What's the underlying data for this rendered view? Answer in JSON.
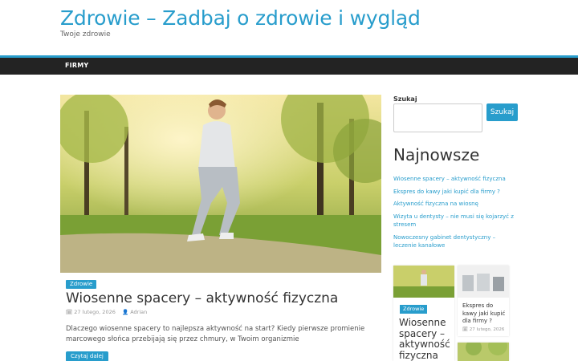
{
  "header": {
    "site_title": "Zdrowie – Zadbaj o zdrowie i wygląd",
    "tagline": "Twoje zdrowie"
  },
  "nav": {
    "items": [
      {
        "label": "FIRMY"
      }
    ]
  },
  "post": {
    "category": "Zdrowie",
    "title": "Wiosenne spacery – aktywność fizyczna",
    "date": "27 lutego, 2026",
    "author": "Adrian",
    "excerpt": "Dlaczego wiosenne spacery to najlepsza aktywność na start? Kiedy pierwsze promienie marcowego słońca przebijają się przez chmury, w Twoim organizmie",
    "read_more": "Czytaj dalej"
  },
  "sidebar": {
    "search_label": "Szukaj",
    "search_placeholder": "",
    "search_button": "Szukaj",
    "recent_title": "Najnowsze",
    "recent_posts": [
      {
        "label": "Wiosenne spacery – aktywność fizyczna"
      },
      {
        "label": "Ekspres do kawy jaki kupić dla firmy ?"
      },
      {
        "label": "Aktywność fizyczna na wiosnę"
      },
      {
        "label": "Wizyta u dentysty – nie musi się kojarzyć z stresem"
      },
      {
        "label": "Nowoczesny gabinet dentystyczny – leczenie kanałowe"
      }
    ],
    "cards": [
      {
        "category": "Zdrowie",
        "title": "Wiosenne spacery – aktywność fizyczna"
      },
      {
        "title": "Ekspres do kawy jaki kupić dla firmy ?",
        "date": "27 lutego, 2026"
      }
    ]
  },
  "icons": {
    "calendar": "calendar-icon",
    "user": "user-icon"
  },
  "colors": {
    "accent": "#289dcc",
    "nav_bg": "#232323"
  }
}
